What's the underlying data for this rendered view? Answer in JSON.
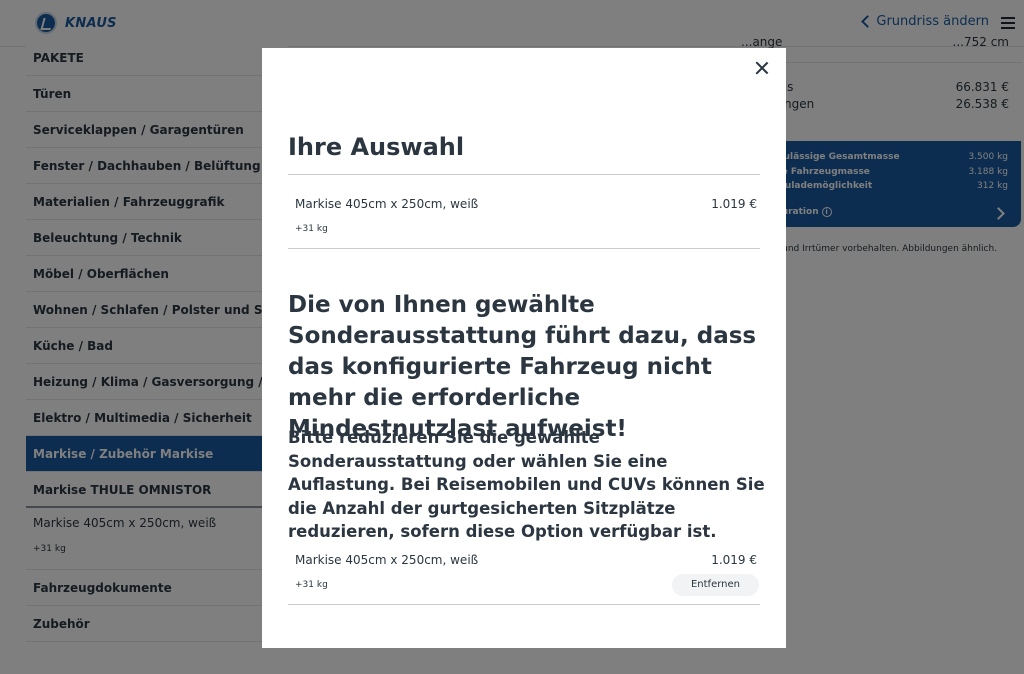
{
  "header": {
    "logo_text": "KNAUS",
    "back_label": "Grundriss ändern"
  },
  "sidebar": {
    "items": [
      {
        "label": "PAKETE"
      },
      {
        "label": "Türen"
      },
      {
        "label": "Serviceklappen / Garagentüren"
      },
      {
        "label": "Fenster / Dachhauben / Belüftung"
      },
      {
        "label": "Materialien / Fahrzeuggrafik"
      },
      {
        "label": "Beleuchtung / Technik"
      },
      {
        "label": "Möbel / Oberflächen"
      },
      {
        "label": "Wohnen / Schlafen / Polster und Stoffe"
      },
      {
        "label": "Küche / Bad"
      },
      {
        "label": "Heizung / Klima / Gasversorgung / Wasser"
      },
      {
        "label": "Elektro / Multimedia / Sicherheit"
      },
      {
        "label": "Markise / Zubehör Markise"
      }
    ],
    "sub_item": "Markise THULE OMNISTOR",
    "detail": {
      "name": "Markise 405cm x 250cm, weiß",
      "weight": "+31 kg"
    },
    "items_after": [
      {
        "label": "Fahrzeugdokumente"
      },
      {
        "label": "Zubehör"
      }
    ]
  },
  "right_panel": {
    "top_left": "...ange",
    "top_right": "...752 cm",
    "price1_label": "...eis",
    "price1_value": "66.831 €",
    "price2_label": "...ungen",
    "price2_value": "26.538 €",
    "box": {
      "row1_label": "... zulässige Gesamtmasse",
      "row1_value": "3.500 kg",
      "row2_label": "...he Fahrzeugmasse",
      "row2_value": "3.188 kg",
      "row3_label": "... Zulademöglichkeit",
      "row3_value": "312 kg",
      "config_label": "...guration"
    },
    "note": "...n und Irrtümer vorbehalten. Abbildungen ähnlich."
  },
  "modal": {
    "title": "Ihre Auswahl",
    "item1": {
      "name": "Markise 405cm x 250cm, weiß",
      "price": "1.019 €",
      "weight": "+31 kg"
    },
    "warning_heading": "Die von Ihnen gewählte Sonderausstattung führt dazu, dass das konfigurierte Fahrzeug nicht mehr die erforderliche Mindestnutzlast aufweist!",
    "warning_text": "Bitte reduzieren Sie die gewählte Sonderausstattung oder wählen Sie eine Auflastung. Bei Reisemobilen und CUVs können Sie die Anzahl der gurtgesicherten Sitzplätze reduzieren, sofern diese Option verfügbar ist.",
    "item2": {
      "name": "Markise 405cm x 250cm, weiß",
      "price": "1.019 €",
      "weight": "+31 kg"
    },
    "remove_label": "Entfernen"
  },
  "colors": {
    "brand_blue": "#1a5aa0",
    "text": "#2b3640"
  }
}
